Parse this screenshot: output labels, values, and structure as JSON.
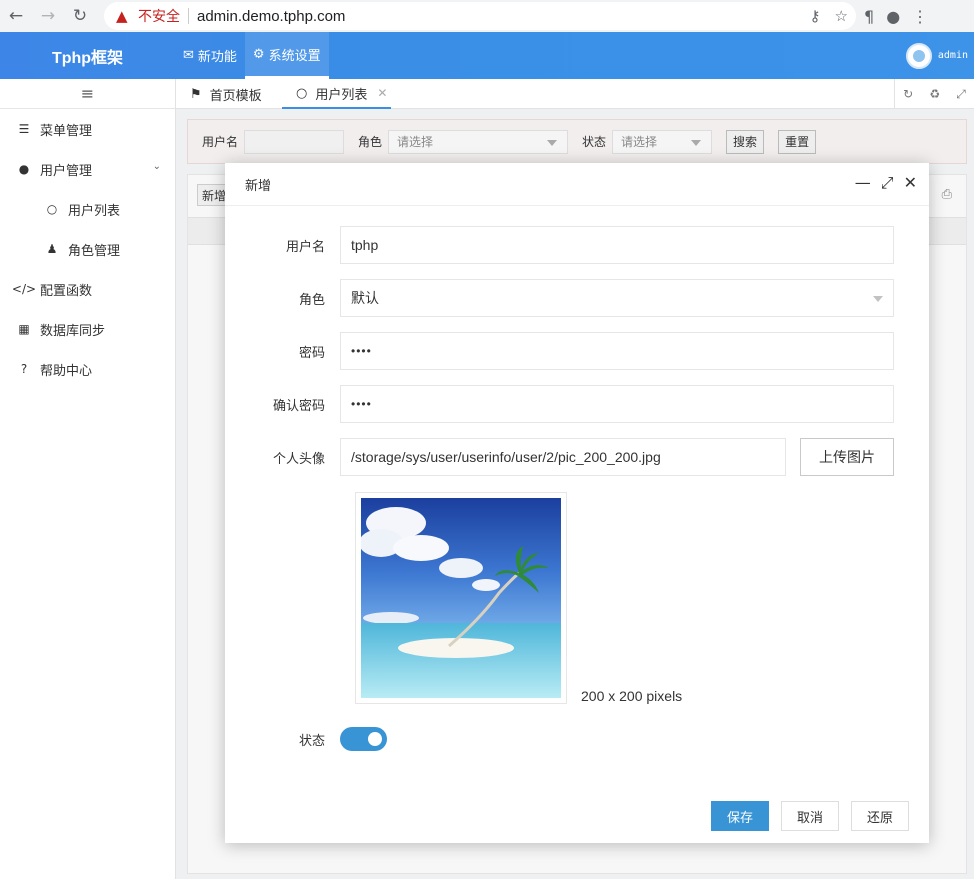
{
  "browser": {
    "security_label": "不安全",
    "url": "admin.demo.tphp.com"
  },
  "header": {
    "brand": "Tphp框架",
    "nav": [
      {
        "label": "新功能",
        "icon": "envelope-open-icon"
      },
      {
        "label": "系统设置",
        "icon": "gear-icon"
      }
    ],
    "username": "admin"
  },
  "sidebar": {
    "items": [
      {
        "label": "菜单管理",
        "icon": "list-icon"
      },
      {
        "label": "用户管理",
        "icon": "user-icon"
      },
      {
        "label": "用户列表",
        "icon": "user-outline-icon"
      },
      {
        "label": "角色管理",
        "icon": "person-icon"
      },
      {
        "label": "配置函数",
        "icon": "code-icon"
      },
      {
        "label": "数据库同步",
        "icon": "table-icon"
      },
      {
        "label": "帮助中心",
        "icon": "question-icon"
      }
    ]
  },
  "tabs": [
    {
      "label": "首页模板",
      "icon": "flag-icon"
    },
    {
      "label": "用户列表",
      "icon": "user-outline-icon"
    }
  ],
  "search": {
    "username_label": "用户名",
    "role_label": "角色",
    "role_placeholder": "请选择",
    "status_label": "状态",
    "status_placeholder": "请选择",
    "search_btn": "搜索",
    "reset_btn": "重置"
  },
  "table": {
    "add_btn": "新增"
  },
  "modal": {
    "title": "新增",
    "fields": {
      "username_label": "用户名",
      "username_value": "tphp",
      "role_label": "角色",
      "role_value": "默认",
      "password_label": "密码",
      "password_value": "••••",
      "confirm_label": "确认密码",
      "confirm_value": "••••",
      "avatar_label": "个人头像",
      "avatar_path": "/storage/sys/user/userinfo/user/2/pic_200_200.jpg",
      "upload_btn": "上传图片",
      "image_note": "200 x 200 pixels",
      "status_label": "状态"
    },
    "status_on": true,
    "buttons": {
      "save": "保存",
      "cancel": "取消",
      "restore": "还原"
    }
  },
  "colors": {
    "header_blue": "#3a8ee6",
    "primary": "#3994d6",
    "insecure_red": "#c5221f"
  }
}
